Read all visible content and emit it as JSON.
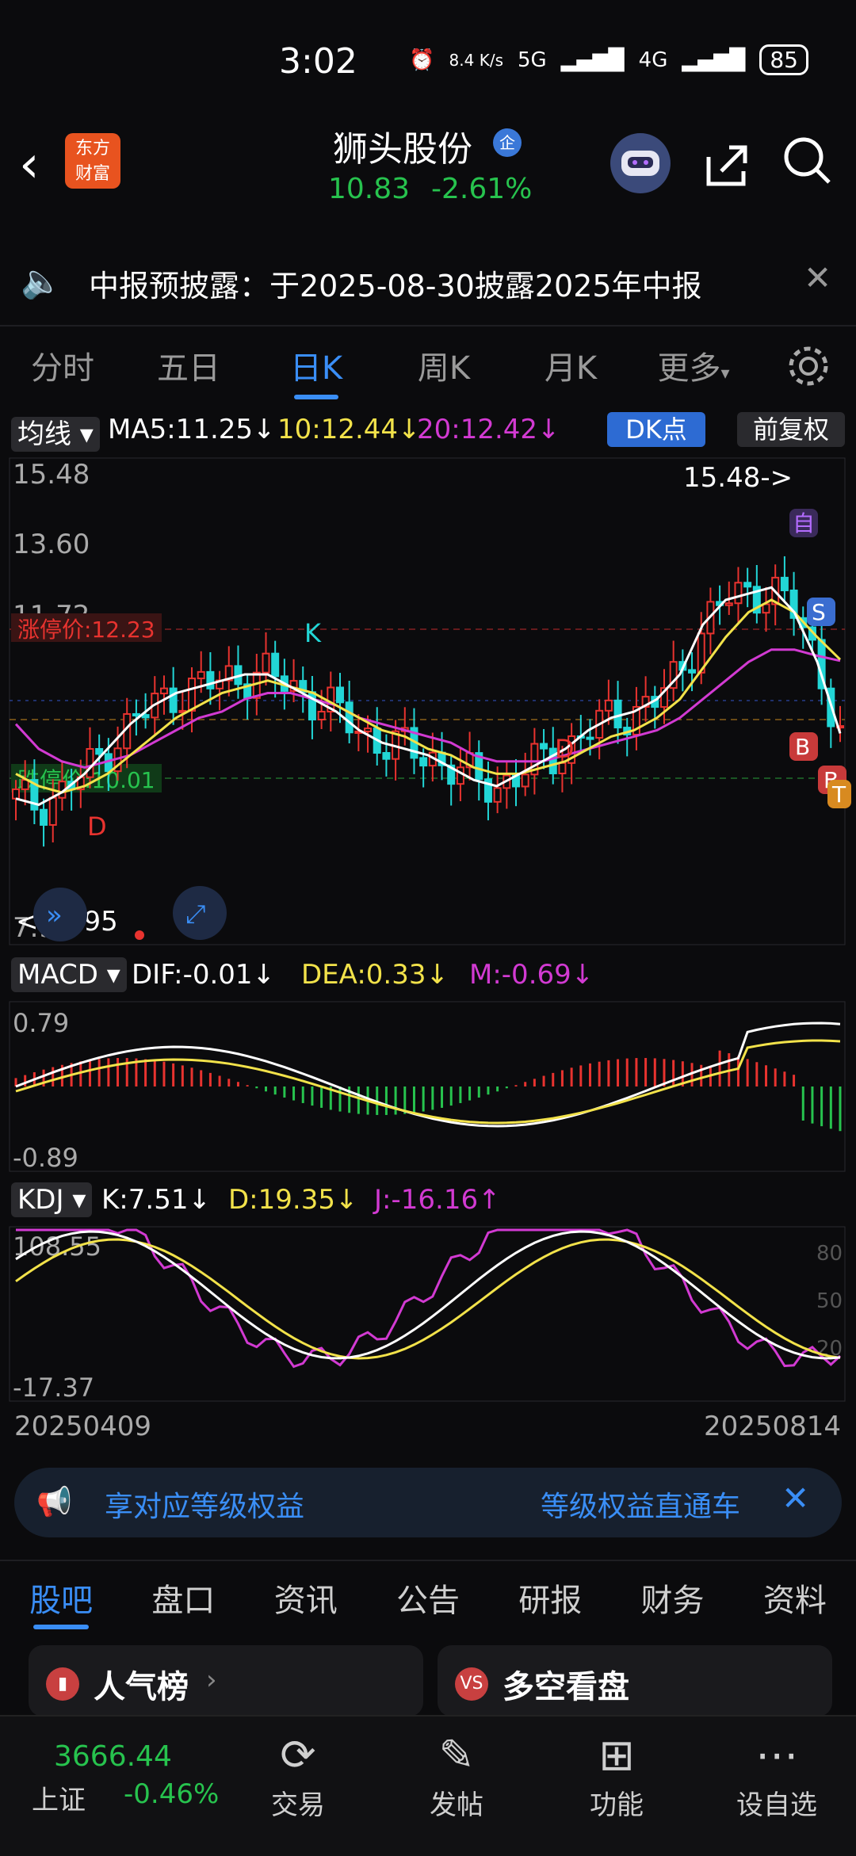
{
  "status": {
    "time": "3:02",
    "net_speed": "8.4 K/s",
    "network": "5G",
    "network2": "4G",
    "battery": "85"
  },
  "header": {
    "logo_line1": "东方",
    "logo_line2": "财富",
    "stock_name": "狮头股份",
    "badge": "企",
    "price": "10.83",
    "change_pct": "-2.61%"
  },
  "notice": {
    "text": "中报预披露：于2025-08-30披露2025年中报"
  },
  "tabs": [
    {
      "label": "分时"
    },
    {
      "label": "五日"
    },
    {
      "label": "日K"
    },
    {
      "label": "周K"
    },
    {
      "label": "月K"
    },
    {
      "label": "更多"
    }
  ],
  "kline": {
    "selector": "均线",
    "ma5": "MA5:11.25↓",
    "ma10": "10:12.44↓",
    "ma20": "20:12.42↓",
    "dk_button": "DK点",
    "adjust_button": "前复权",
    "y_top": "15.48",
    "y_mid1": "13.60",
    "y_mid2": "11.72",
    "y_bottom": "7.95",
    "limit_up": "涨停价:12.23",
    "limit_down": "跌停价:10.01",
    "max_marker": "15.48->",
    "min_marker": "<--7.95",
    "markers": [
      "K",
      "D",
      "D",
      "S",
      "B",
      "B",
      "T",
      "自"
    ]
  },
  "macd": {
    "selector": "MACD",
    "dif": "DIF:-0.01↓",
    "dea": "DEA:0.33↓",
    "m": "M:-0.69↓",
    "y_top": "0.79",
    "y_bottom": "-0.89"
  },
  "kdj": {
    "selector": "KDJ",
    "k": "K:7.51↓",
    "d": "D:19.35↓",
    "j": "J:-16.16↑",
    "y_top": "108.55",
    "y_bottom": "-17.37",
    "r80": "80",
    "r50": "50",
    "r20": "20"
  },
  "dates": {
    "start": "20250409",
    "end": "20250814"
  },
  "promo": {
    "text": "享对应等级权益",
    "link": "等级权益直通车"
  },
  "subtabs": [
    {
      "label": "股吧"
    },
    {
      "label": "盘口"
    },
    {
      "label": "资讯"
    },
    {
      "label": "公告"
    },
    {
      "label": "研报"
    },
    {
      "label": "财务"
    },
    {
      "label": "资料"
    }
  ],
  "cards": [
    {
      "title": "人气榜"
    },
    {
      "title": "多空看盘"
    }
  ],
  "bottom_nav": {
    "index_value": "3666.44",
    "index_name": "上证",
    "index_change": "-0.46%",
    "items": [
      {
        "label": "交易"
      },
      {
        "label": "发帖"
      },
      {
        "label": "功能"
      },
      {
        "label": "设自选"
      }
    ]
  },
  "colors": {
    "up": "#e8332f",
    "down": "#22d6d6",
    "accent": "#3a8ef6",
    "green": "#27c34e",
    "yellow": "#f2e24a",
    "magenta": "#d23ad2"
  },
  "chart_data": {
    "type": "candlestick",
    "ylim": [
      7.95,
      15.48
    ],
    "ma5": [
      10.2,
      10.1,
      10.3,
      10.6,
      11.0,
      11.4,
      11.7,
      11.9,
      12.0,
      12.1,
      12.2,
      12.2,
      12.0,
      11.8,
      11.6,
      11.3,
      11.1,
      11.0,
      10.9,
      10.7,
      10.5,
      10.4,
      10.6,
      10.8,
      11.0,
      11.3,
      11.5,
      11.6,
      11.8,
      12.2,
      13.0,
      13.4,
      13.5,
      13.6,
      13.2,
      12.4,
      11.25
    ],
    "ma10": [
      10.6,
      10.4,
      10.3,
      10.4,
      10.6,
      10.9,
      11.2,
      11.5,
      11.7,
      11.9,
      12.0,
      12.1,
      12.0,
      11.9,
      11.7,
      11.5,
      11.3,
      11.2,
      11.0,
      10.9,
      10.7,
      10.6,
      10.6,
      10.7,
      10.8,
      11.0,
      11.2,
      11.3,
      11.5,
      11.8,
      12.3,
      12.8,
      13.2,
      13.4,
      13.2,
      12.8,
      12.44
    ],
    "ma20": [
      11.4,
      11.0,
      10.8,
      10.7,
      10.8,
      10.9,
      11.1,
      11.3,
      11.5,
      11.6,
      11.8,
      11.9,
      11.9,
      11.8,
      11.7,
      11.5,
      11.4,
      11.3,
      11.2,
      11.1,
      10.9,
      10.8,
      10.8,
      10.8,
      10.9,
      11.0,
      11.1,
      11.2,
      11.3,
      11.5,
      11.8,
      12.1,
      12.4,
      12.6,
      12.6,
      12.5,
      12.42
    ]
  }
}
